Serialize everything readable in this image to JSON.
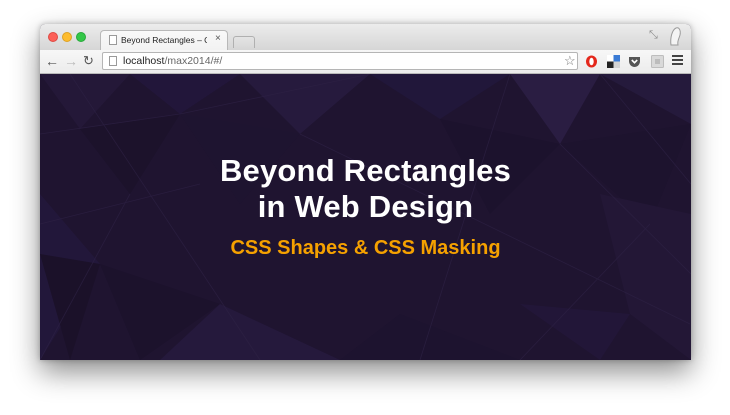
{
  "browser": {
    "tab": {
      "title": "Beyond Rectangles – CSS S",
      "close_glyph": "×"
    },
    "toolbar": {
      "back_glyph": "←",
      "forward_glyph": "→",
      "reload_glyph": "↻",
      "url_host": "localhost",
      "url_path": "/max2014/#/",
      "star_glyph": "☆"
    },
    "extensions": [
      "opera-icon",
      "delicious-icon",
      "pocket-icon",
      "extension-icon"
    ],
    "restore_glyph": "⤡"
  },
  "slide": {
    "title_line1": "Beyond Rectangles",
    "title_line2": "in Web Design",
    "subtitle": "CSS Shapes & CSS Masking"
  },
  "colors": {
    "background": "#1f1430",
    "title": "#ffffff",
    "subtitle": "#f5a100"
  }
}
